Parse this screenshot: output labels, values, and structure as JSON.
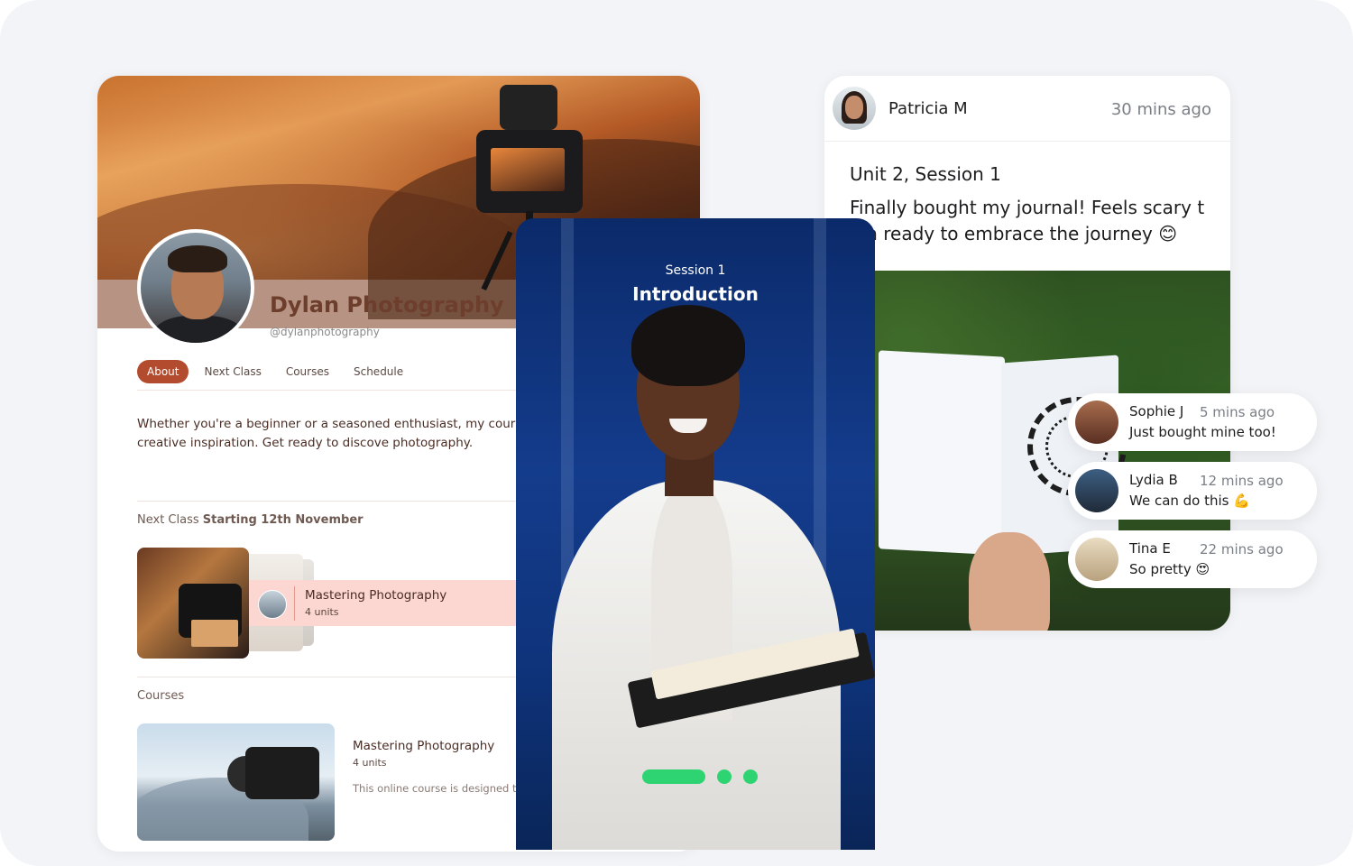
{
  "profile": {
    "name": "Dylan Photography",
    "handle": "@dylanphotography",
    "tabs": [
      "About",
      "Next Class",
      "Courses",
      "Schedule"
    ],
    "about": "Whether you're a beginner or a seasoned enthusiast, my courses o technical knowledge and creative inspiration. Get ready to discove photography.",
    "next_class_prefix": "Next Class",
    "next_class_date": "Starting 12th November",
    "next_class_title": "Mastering Photography",
    "next_class_units": "4 units",
    "courses_label": "Courses",
    "course_title": "Mastering Photography",
    "course_units": "4 units",
    "course_desc": "This online course is designed to journey from novice photograph"
  },
  "video": {
    "session_number": "Session 1",
    "session_title": "Introduction"
  },
  "post": {
    "author": "Patricia M",
    "time": "30 mins ago",
    "unit": "Unit 2, Session 1",
    "body": "Finally bought my journal! Feels scary t I'm ready to embrace the journey 😊"
  },
  "comments": [
    {
      "name": "Sophie J",
      "time": "5 mins ago",
      "text": "Just bought mine too!"
    },
    {
      "name": "Lydia B",
      "time": "12 mins ago",
      "text": "We can do this 💪"
    },
    {
      "name": "Tina E",
      "time": "22 mins ago",
      "text": "So pretty 😍"
    }
  ],
  "colors": {
    "accent": "#b34b2e",
    "brand_text": "#6e3e2c",
    "highlight": "#fcd6d0",
    "carousel_dot": "#2fd472",
    "video_bg": "#123a86"
  }
}
